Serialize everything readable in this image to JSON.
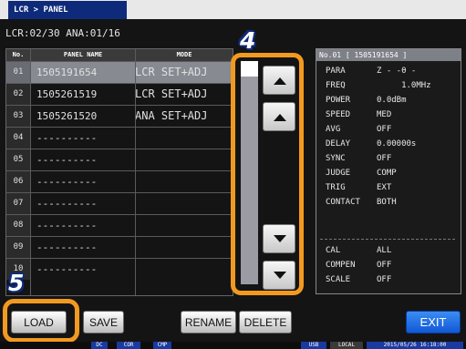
{
  "title": "LCR > PANEL",
  "status": "LCR:02/30  ANA:01/16",
  "table": {
    "headers": [
      "No.",
      "PANEL NAME",
      "MODE"
    ],
    "rows": [
      {
        "no": "01",
        "name": "1505191654",
        "mode": "LCR SET+ADJ"
      },
      {
        "no": "02",
        "name": "1505261519",
        "mode": "LCR SET+ADJ"
      },
      {
        "no": "03",
        "name": "1505261520",
        "mode": "ANA SET+ADJ"
      },
      {
        "no": "04",
        "name": "----------",
        "mode": ""
      },
      {
        "no": "05",
        "name": "----------",
        "mode": ""
      },
      {
        "no": "06",
        "name": "----------",
        "mode": ""
      },
      {
        "no": "07",
        "name": "----------",
        "mode": ""
      },
      {
        "no": "08",
        "name": "----------",
        "mode": ""
      },
      {
        "no": "09",
        "name": "----------",
        "mode": ""
      },
      {
        "no": "10",
        "name": "----------",
        "mode": ""
      }
    ]
  },
  "info": {
    "header": "No.01 [ 1505191654 ]",
    "rows": [
      {
        "key": "PARA",
        "value": "Z -  -θ -"
      },
      {
        "key": "FREQ",
        "value": "     1.0MHz"
      },
      {
        "key": "POWER",
        "value": "0.0dBm"
      },
      {
        "key": "SPEED",
        "value": "MED"
      },
      {
        "key": "AVG",
        "value": "OFF"
      },
      {
        "key": "DELAY",
        "value": "0.00000s"
      },
      {
        "key": "SYNC",
        "value": "OFF"
      },
      {
        "key": "JUDGE",
        "value": "COMP"
      },
      {
        "key": "TRIG",
        "value": "EXT"
      },
      {
        "key": "CONTACT",
        "value": "BOTH"
      }
    ],
    "rows2": [
      {
        "key": "CAL",
        "value": "ALL"
      },
      {
        "key": "COMPEN",
        "value": "OFF"
      },
      {
        "key": "SCALE",
        "value": "OFF"
      }
    ]
  },
  "callouts": {
    "scroll": "4",
    "load": "5"
  },
  "buttons": {
    "load": "LOAD",
    "save": "SAVE",
    "rename": "RENAME",
    "delete": "DELETE",
    "exit": "EXIT"
  },
  "bottom": {
    "ind1": "DC",
    "ind2": "COR",
    "ind3": "CMP",
    "usb": "USB",
    "local": "LOCAL",
    "datetime": "2015/05/26 16:18:00"
  },
  "colors": {
    "highlight": "#f29a1f",
    "title_bg": "#0e2a7a",
    "selected_row": "#888a92",
    "exit": "#1a6ee8"
  }
}
